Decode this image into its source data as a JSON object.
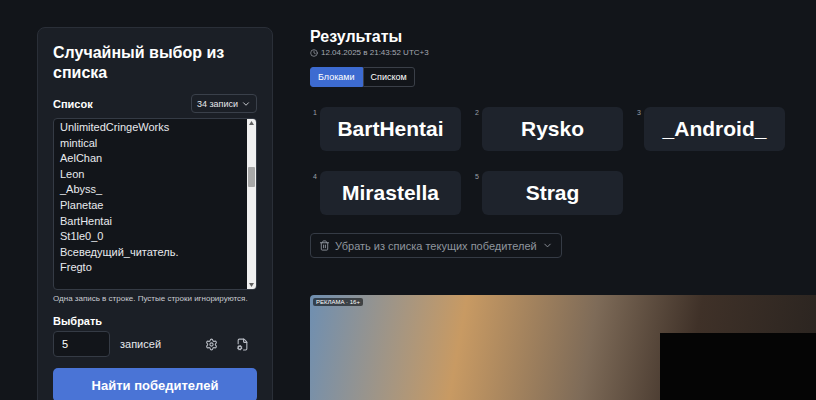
{
  "settings": {
    "title": "Случайный выбор из списка",
    "list_label": "Список",
    "count_button": "34 записи",
    "entries": [
      "UnlimitedCringeWorks",
      "mintical",
      "AelChan",
      "Leon",
      "_Abyss_",
      "Planetae",
      "BartHentai",
      "St1le0_0",
      "Всеведущий_читатель.",
      "Fregto"
    ],
    "scrollbar": {
      "level": 0.3
    },
    "hint": "Одна запись в строке. Пустые строки игнорируются.",
    "pick_label": "Выбрать",
    "pick_value": "5",
    "pick_unit": "записей",
    "submit": "Найти победителей"
  },
  "results": {
    "title": "Результаты",
    "timestamp": "12.04.2025 в 21:43:52 UTC+3",
    "tabs": [
      {
        "label": "Блоками",
        "selected": true
      },
      {
        "label": "Списком",
        "selected": false
      }
    ],
    "winners": [
      {
        "number": "1",
        "name": "BartHentai"
      },
      {
        "number": "2",
        "name": "Rysko"
      },
      {
        "number": "3",
        "name": "_Android_"
      },
      {
        "number": "4",
        "name": "Mirastella"
      },
      {
        "number": "5",
        "name": "Strag"
      }
    ],
    "remove_button": "Убрать из списка текущих победителей"
  },
  "ad": {
    "label": "РЕКЛАМА · 16+"
  }
}
